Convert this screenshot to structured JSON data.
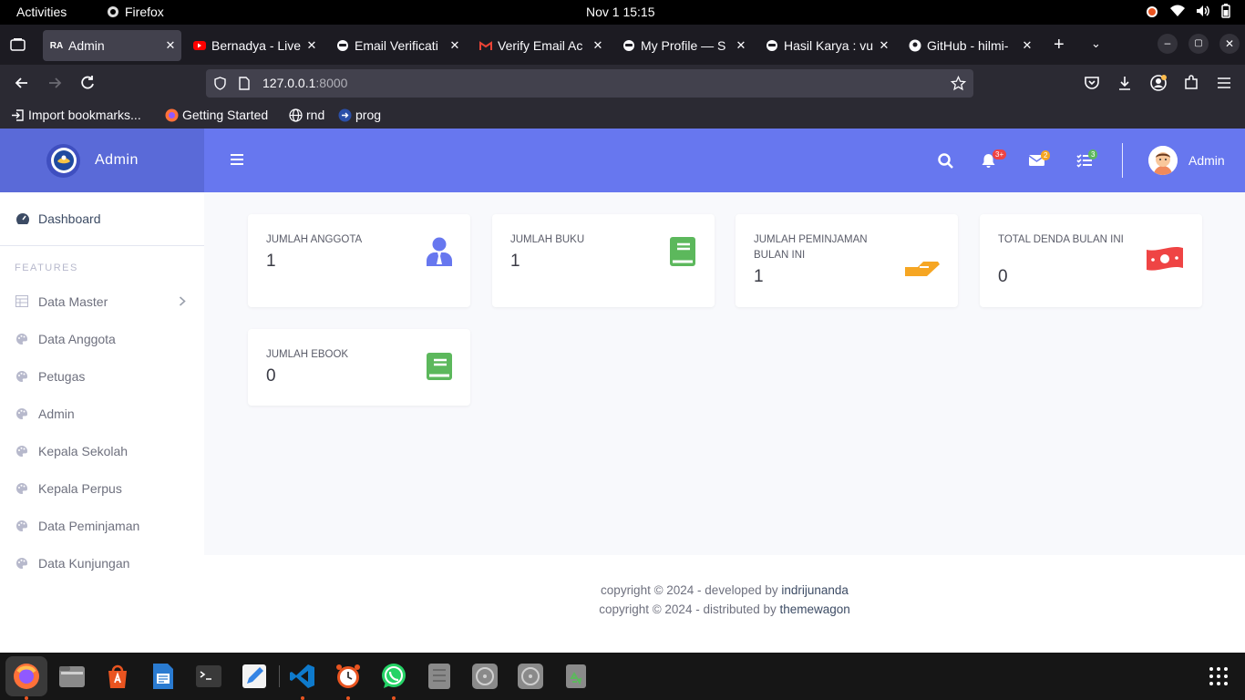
{
  "system": {
    "activities": "Activities",
    "app_name": "Firefox",
    "clock": "Nov 1  15:15"
  },
  "tabs": [
    {
      "title": "Admin",
      "active": true
    },
    {
      "title": "Bernadya - Live"
    },
    {
      "title": "Email Verificati"
    },
    {
      "title": "Verify Email Ac"
    },
    {
      "title": "My Profile — S"
    },
    {
      "title": "Hasil Karya : vu"
    },
    {
      "title": "GitHub - hilmi-"
    }
  ],
  "url": {
    "host": "127.0.0.1",
    "port": ":8000"
  },
  "bookmarks": [
    "Import bookmarks...",
    "Getting Started",
    "rnd",
    "prog"
  ],
  "brand": {
    "name": "Admin"
  },
  "header": {
    "notif_count": "3+",
    "mail_count": "2",
    "task_count": "3",
    "user_name": "Admin"
  },
  "sidebar": {
    "dashboard": "Dashboard",
    "section": "FEATURES",
    "items": [
      "Data Master",
      "Data Anggota",
      "Petugas",
      "Admin",
      "Kepala Sekolah",
      "Kepala Perpus",
      "Data Peminjaman",
      "Data Kunjungan"
    ]
  },
  "cards": [
    {
      "label": "JUMLAH ANGGOTA",
      "value": "1"
    },
    {
      "label": "JUMLAH BUKU",
      "value": "1"
    },
    {
      "label": "JUMLAH PEMINJAMAN BULAN INI",
      "value": "1"
    },
    {
      "label": "TOTAL DENDA BULAN INI",
      "value": "0"
    },
    {
      "label": "JUMLAH EBOOK",
      "value": "0"
    }
  ],
  "footer": {
    "line1_prefix": "copyright © 2024 - developed by ",
    "line1_link": "indrijunanda",
    "line2_prefix": "copyright © 2024 - distributed by ",
    "line2_link": "themewagon"
  },
  "colors": {
    "primary": "#6777ef",
    "brand": "#5a6ad8",
    "success": "#5cb85c",
    "warning": "#f6a623",
    "danger": "#ef4444"
  }
}
